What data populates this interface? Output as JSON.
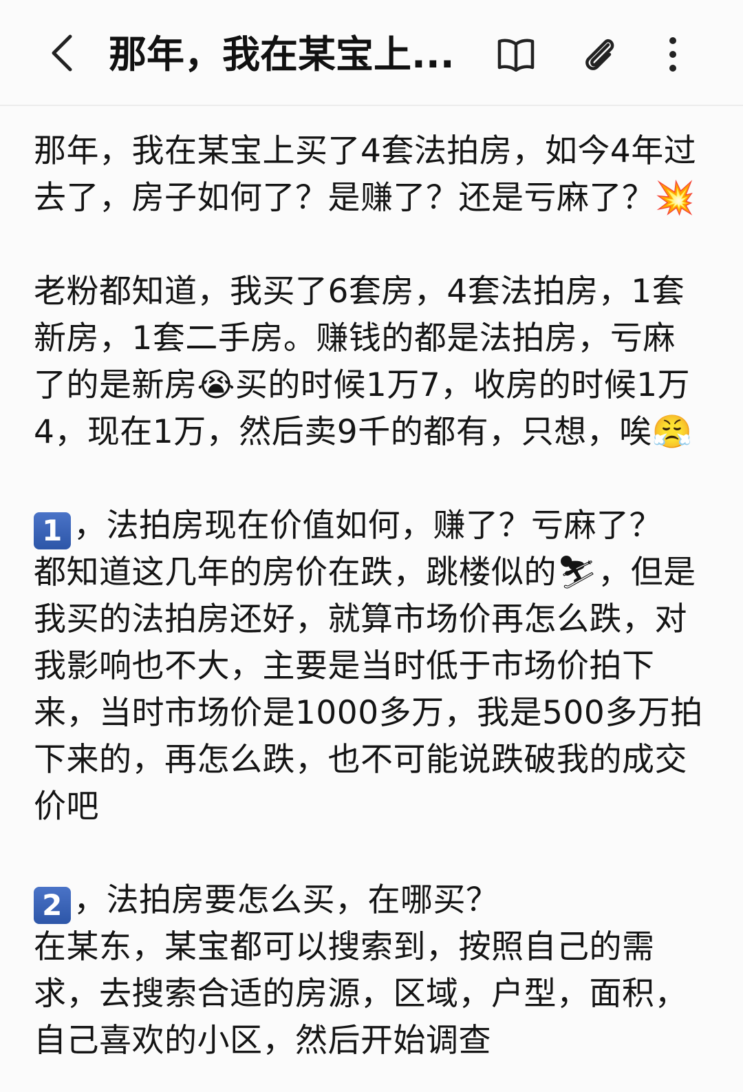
{
  "header": {
    "back_icon": "chevron-left-icon",
    "title": "那年，我在某宝上...",
    "book_icon": "open-book-icon",
    "clip_icon": "paperclip-icon",
    "more_icon": "more-vertical-icon"
  },
  "article": {
    "intro_text": "那年，我在某宝上买了4套法拍房，如今4年过去了，房子如何了？是赚了？还是亏麻了？",
    "intro_emoji": "💥",
    "para2_a": "老粉都知道，我买了6套房，4套法拍房，1套新房，1套二手房。赚钱的都是法拍房，亏麻了的是新房",
    "para2_emoji1": "😭",
    "para2_b": "买的时候1万7，收房的时候1万4，现在1万，然后卖9千的都有，只想，唉",
    "para2_emoji2": "😤",
    "sec1_badge": "1",
    "sec1_heading": "，法拍房现在价值如何，赚了？亏麻了？",
    "sec1_a": "都知道这几年的房价在跌，跳楼似的",
    "sec1_emoji": "⛷",
    "sec1_b": "，但是我买的法拍房还好，就算市场价再怎么跌，对我影响也不大，主要是当时低于市场价拍下来，当时市场价是1000多万，我是500多万拍下来的，再怎么跌，也不可能说跌破我的成交价吧",
    "sec2_badge": "2",
    "sec2_heading": "，法拍房要怎么买，在哪买？",
    "sec2_text": "在某东，某宝都可以搜索到，按照自己的需求，去搜索合适的房源，区域，户型，面积，自己喜欢的小区，然后开始调查"
  }
}
